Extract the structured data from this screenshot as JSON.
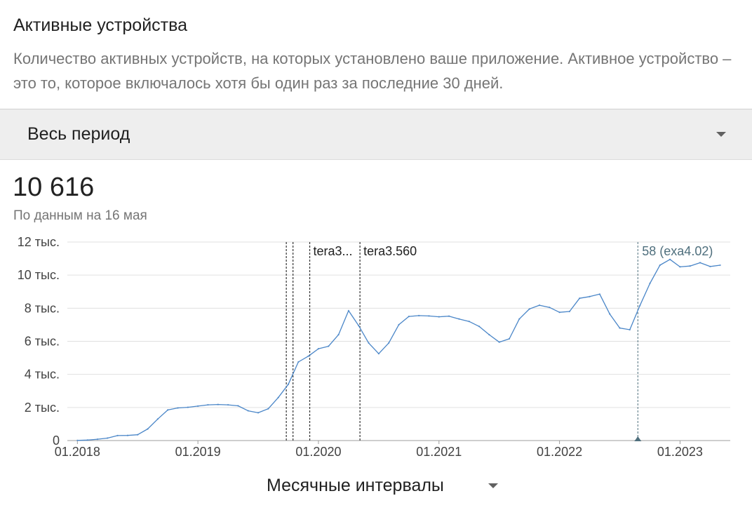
{
  "header": {
    "title": "Активные устройства",
    "description": "Количество активных устройств, на которых установлено ваше приложение. Активное устройство – это то, которое включалось хотя бы один раз за последние 30 дней."
  },
  "period_selector": {
    "label": "Весь период",
    "icon": "chevron-down-icon"
  },
  "metric": {
    "value": "10 616",
    "as_of": "По данным на 16 мая"
  },
  "interval_selector": {
    "label": "Месячные интервалы",
    "icon": "chevron-down-icon"
  },
  "colors": {
    "line": "#4a86c8",
    "grid": "#e0e0e0",
    "marker": "#4f6f7d",
    "release": "#333333"
  },
  "chart_data": {
    "type": "line",
    "title": "",
    "xlabel": "",
    "ylabel": "",
    "x_tick_labels": [
      "01.2018",
      "01.2019",
      "01.2020",
      "01.2021",
      "01.2022",
      "01.2023"
    ],
    "y_tick_labels": [
      "0",
      "2 тыс.",
      "4 тыс.",
      "6 тыс.",
      "8 тыс.",
      "10 тыс.",
      "12 тыс."
    ],
    "ylim": [
      0,
      12000
    ],
    "x_range": [
      "2017-12",
      "2023-06"
    ],
    "grid": true,
    "series": [
      {
        "points": [
          [
            "2018-01",
            10
          ],
          [
            "2018-02",
            30
          ],
          [
            "2018-03",
            80
          ],
          [
            "2018-04",
            150
          ],
          [
            "2018-05",
            300
          ],
          [
            "2018-06",
            310
          ],
          [
            "2018-07",
            350
          ],
          [
            "2018-08",
            700
          ],
          [
            "2018-09",
            1300
          ],
          [
            "2018-10",
            1850
          ],
          [
            "2018-11",
            1970
          ],
          [
            "2018-12",
            2010
          ],
          [
            "2019-01",
            2080
          ],
          [
            "2019-02",
            2160
          ],
          [
            "2019-03",
            2180
          ],
          [
            "2019-04",
            2160
          ],
          [
            "2019-05",
            2100
          ],
          [
            "2019-06",
            1800
          ],
          [
            "2019-07",
            1680
          ],
          [
            "2019-08",
            1920
          ],
          [
            "2019-09",
            2600
          ],
          [
            "2019-10",
            3400
          ],
          [
            "2019-11",
            4750
          ],
          [
            "2019-12",
            5100
          ],
          [
            "2020-01",
            5550
          ],
          [
            "2020-02",
            5700
          ],
          [
            "2020-03",
            6400
          ],
          [
            "2020-04",
            7850
          ],
          [
            "2020-05",
            6950
          ],
          [
            "2020-06",
            5900
          ],
          [
            "2020-07",
            5250
          ],
          [
            "2020-08",
            5900
          ],
          [
            "2020-09",
            7000
          ],
          [
            "2020-10",
            7500
          ],
          [
            "2020-11",
            7550
          ],
          [
            "2020-12",
            7530
          ],
          [
            "2021-01",
            7480
          ],
          [
            "2021-02",
            7520
          ],
          [
            "2021-03",
            7350
          ],
          [
            "2021-04",
            7200
          ],
          [
            "2021-05",
            6900
          ],
          [
            "2021-06",
            6400
          ],
          [
            "2021-07",
            5950
          ],
          [
            "2021-08",
            6150
          ],
          [
            "2021-09",
            7350
          ],
          [
            "2021-10",
            7950
          ],
          [
            "2021-11",
            8180
          ],
          [
            "2021-12",
            8050
          ],
          [
            "2022-01",
            7750
          ],
          [
            "2022-02",
            7800
          ],
          [
            "2022-03",
            8600
          ],
          [
            "2022-04",
            8700
          ],
          [
            "2022-05",
            8850
          ],
          [
            "2022-06",
            7650
          ],
          [
            "2022-07",
            6800
          ],
          [
            "2022-08",
            6700
          ],
          [
            "2022-09",
            8150
          ],
          [
            "2022-10",
            9500
          ],
          [
            "2022-11",
            10600
          ],
          [
            "2022-12",
            10950
          ],
          [
            "2023-01",
            10500
          ],
          [
            "2023-02",
            10550
          ],
          [
            "2023-03",
            10750
          ],
          [
            "2023-04",
            10520
          ],
          [
            "2023-05",
            10600
          ]
        ]
      }
    ],
    "annotations": [
      {
        "x": "2019-09-25",
        "label": ""
      },
      {
        "x": "2019-10-15",
        "label": ""
      },
      {
        "x": "2019-12-05",
        "label": "tera3..."
      },
      {
        "x": "2020-05-05",
        "label": "tera3.560"
      },
      {
        "x": "2022-08-25",
        "label": "58 (exa4.02)",
        "highlight": true
      }
    ]
  }
}
